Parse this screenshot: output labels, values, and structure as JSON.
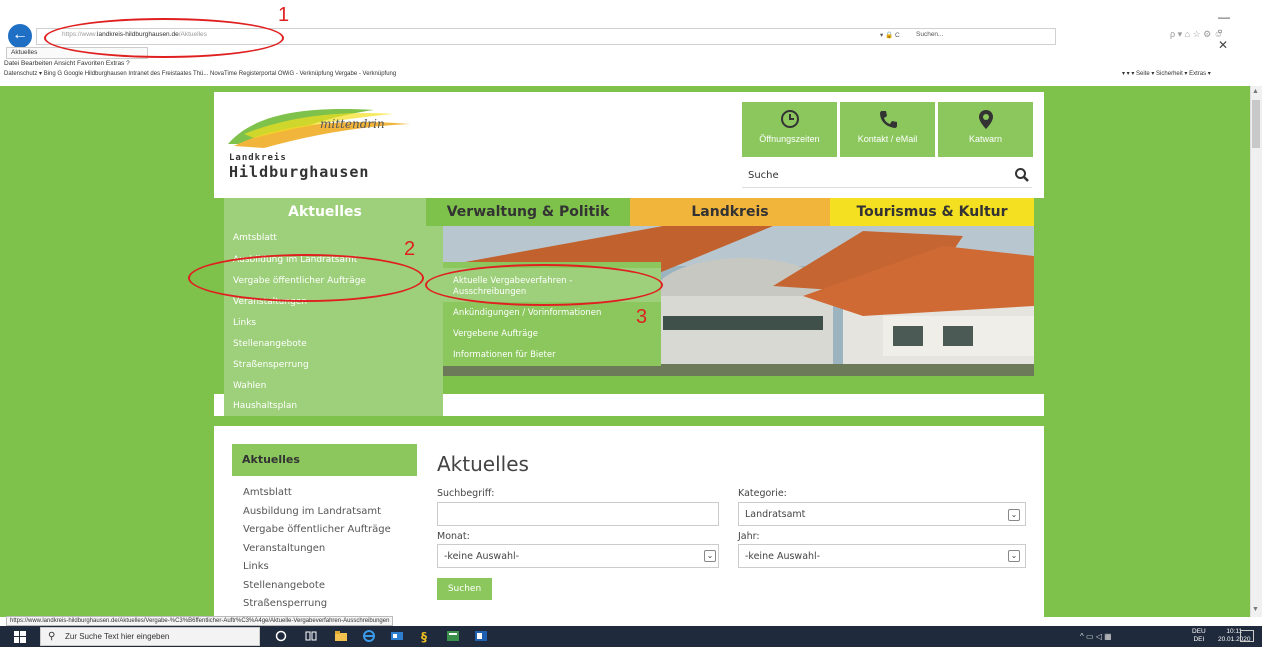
{
  "browser": {
    "url_prefix": "https://www.",
    "url_host": "landkreis-hildburghausen.de",
    "url_path": "/Aktuelles",
    "addr_right": "▾ 🔒 C",
    "search_placeholder": "Suchen...",
    "tab_label": "Aktuelles",
    "menu": "Datei  Bearbeiten  Ansicht  Favoriten  Extras  ?",
    "favorites": "Datenschutz ▾  Bing  G Google  Hildburghausen  Intranet des Freistaates Thü...  NovaTime  Registerportal  OWiG - Verknüpfung  Vergabe - Verknüpfung",
    "favorites_right": "▾ ▾ ▾ Seite ▾ Sicherheit ▾ Extras ▾",
    "status_url": "https://www.landkreis-hildburghausen.de/Aktuelles/Vergabe-%C3%B6ffentlicher-Auftr%C3%A4ge/Aktuelle-Vergabeverfahren-Ausschreibungen",
    "window_controls": "— ▫ ✕",
    "toolbar_right": "ρ ▾ ⌂ ☆ ⚙ ☺"
  },
  "annotations": {
    "one": "1",
    "two": "2",
    "three": "3"
  },
  "header": {
    "logo_script": "mittendrin",
    "logo_small": "Landkreis",
    "logo_big": "Hildburghausen",
    "quick_links": [
      "Öffnungszeiten",
      "Kontakt / eMail",
      "Katwarn"
    ],
    "search_label": "Suche"
  },
  "nav": [
    "Aktuelles",
    "Verwaltung & Politik",
    "Landkreis",
    "Tourismus & Kultur"
  ],
  "dropdown": [
    "Amtsblatt",
    "Ausbildung im Landratsamt",
    "Vergabe öffentlicher Aufträge",
    "Veranstaltungen",
    "Links",
    "Stellenangebote",
    "Straßensperrung",
    "Wahlen",
    "Haushaltsplan"
  ],
  "submenu": [
    "Aktuelle Vergabeverfahren -",
    "Ausschreibungen",
    "Ankündigungen / Vorinformationen",
    "Vergebene Aufträge",
    "Informationen für Bieter"
  ],
  "sidebar": {
    "heading": "Aktuelles",
    "items": [
      "Amtsblatt",
      "Ausbildung im Landratsamt",
      "Vergabe öffentlicher Aufträge",
      "Veranstaltungen",
      "Links",
      "Stellenangebote",
      "Straßensperrung"
    ]
  },
  "main": {
    "title": "Aktuelles",
    "suchbegriff_label": "Suchbegriff:",
    "suchbegriff_value": "",
    "kategorie_label": "Kategorie:",
    "kategorie_value": "Landratsamt",
    "monat_label": "Monat:",
    "monat_value": "-keine Auswahl-",
    "jahr_label": "Jahr:",
    "jahr_value": "-keine Auswahl-",
    "search_button": "Suchen"
  },
  "taskbar": {
    "search_placeholder": "Zur Suche Text hier eingeben",
    "tray": "^ ▭ ◁ ▦",
    "lang_1": "DEU",
    "lang_2": "DEI",
    "time": "10:11",
    "date": "20.01.2020"
  },
  "colors": {
    "green": "#7ec14b",
    "light_green": "#9ed07b",
    "orange": "#f2b53b",
    "yellow": "#f4df20",
    "annotation_red": "#e02020"
  }
}
